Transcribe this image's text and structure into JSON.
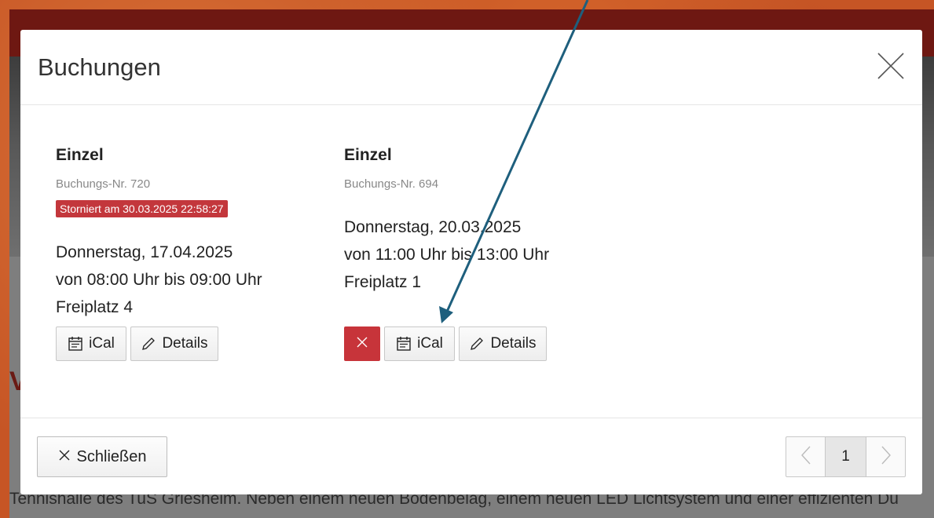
{
  "background": {
    "heading_fragment": "V",
    "text_fragment": "Tennishalle des TuS Griesheim. Neben einem neuen Bodenbelag, einem neuen LED Lichtsystem und einer effizienten Du"
  },
  "modal": {
    "title": "Buchungen",
    "bookings": [
      {
        "title": "Einzel",
        "number": "Buchungs-Nr. 720",
        "status_badge": "Storniert am 30.03.2025 22:58:27",
        "date": "Donnerstag, 17.04.2025",
        "time": "von 08:00 Uhr bis 09:00 Uhr",
        "court": "Freiplatz 4",
        "ical_label": "iCal",
        "details_label": "Details"
      },
      {
        "title": "Einzel",
        "number": "Buchungs-Nr. 694",
        "date": "Donnerstag, 20.03.2025",
        "time": "von 11:00 Uhr bis 13:00 Uhr",
        "court": "Freiplatz 1",
        "ical_label": "iCal",
        "details_label": "Details"
      }
    ],
    "footer": {
      "close_label": "Schließen",
      "current_page": "1"
    }
  },
  "colors": {
    "frame_orange": "#c65525",
    "danger_red": "#c7343a",
    "arrow_blue": "#1e5f7d"
  }
}
